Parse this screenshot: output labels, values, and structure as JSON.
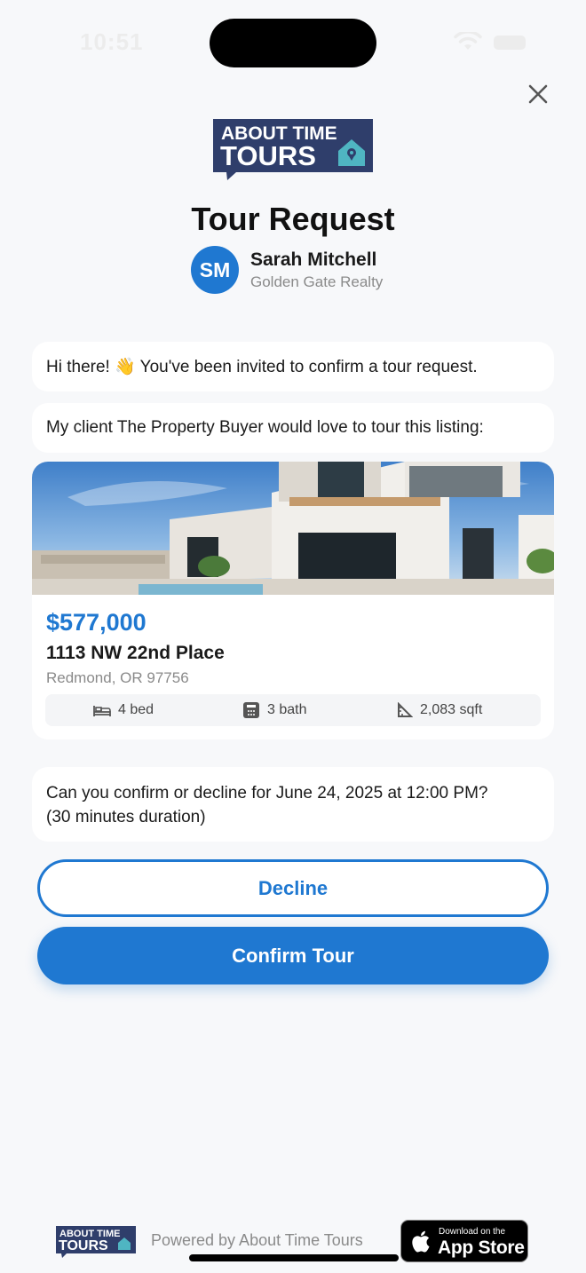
{
  "status_bar": {
    "time": "10:51"
  },
  "brand": {
    "logo_line1": "ABOUT TIME",
    "logo_line2": "TOURS",
    "navy": "#2f3e6b",
    "teal": "#4fb5c2",
    "accent": "#1f78d1"
  },
  "page": {
    "title": "Tour Request"
  },
  "agent": {
    "initials": "SM",
    "name": "Sarah Mitchell",
    "company": "Golden Gate Realty"
  },
  "messages": {
    "greeting": "Hi there! 👋 You've been invited to confirm a tour request.",
    "intro": "My client The Property Buyer would love to tour this listing:",
    "confirm_line1": "Can you confirm or decline for June 24, 2025 at 12:00 PM?",
    "confirm_line2": "(30 minutes duration)"
  },
  "listing": {
    "price": "$577,000",
    "address": "1113 NW 22nd Place",
    "city": "Redmond, OR 97756",
    "beds": "4 bed",
    "baths": "3 bath",
    "sqft": "2,083 sqft"
  },
  "actions": {
    "decline_label": "Decline",
    "confirm_label": "Confirm Tour"
  },
  "footer": {
    "powered_by": "Powered by About Time Tours",
    "appstore_small": "Download on the",
    "appstore_big": "App Store"
  },
  "icons": [
    "close-icon",
    "bed-icon",
    "bath-icon",
    "ruler-icon",
    "apple-icon",
    "wifi-icon",
    "battery-icon"
  ]
}
